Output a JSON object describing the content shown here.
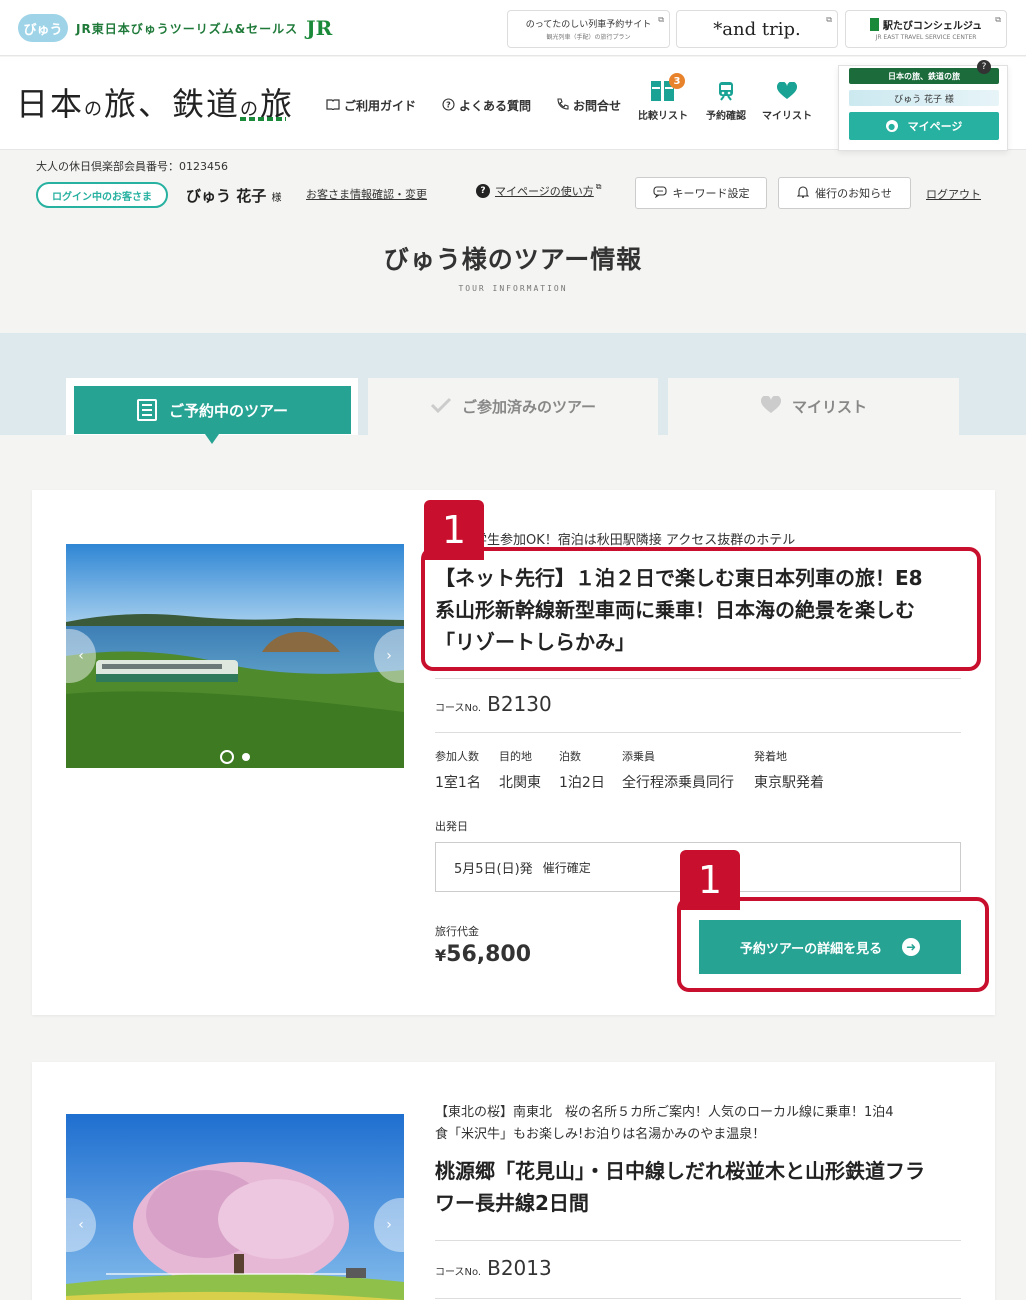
{
  "topbar": {
    "brand_logo": "びゅう",
    "brand_company": "JR東日本びゅうツーリズム&セールス",
    "brand_jr": "JR",
    "ext_sites": [
      {
        "main": "のってたのしい列車予約サイト",
        "sub": "観光列車（手配）の旅行プラン"
      },
      {
        "main": "*and trip.",
        "sub": ""
      },
      {
        "main": "駅たびコンシェルジュ",
        "sub": "JR EAST TRAVEL SERVICE CENTER"
      }
    ],
    "external_icon": "external-link-icon"
  },
  "nav": {
    "logo_part1": "日本",
    "logo_small1": "の",
    "logo_part2": "旅、鉄道",
    "logo_small2": "の",
    "logo_part3": "旅",
    "links": [
      {
        "label": "ご利用ガイド",
        "icon": "book-icon"
      },
      {
        "label": "よくある質問",
        "icon": "question-icon"
      },
      {
        "label": "お問合せ",
        "icon": "phone-icon"
      }
    ],
    "icon_items": [
      {
        "label": "比較リスト",
        "icon": "compare-icon",
        "badge": "3"
      },
      {
        "label": "予約確認",
        "icon": "train-icon"
      },
      {
        "label": "マイリスト",
        "icon": "heart-icon"
      }
    ],
    "mypage": {
      "top": "日本の旅、鉄道の旅",
      "help": "?",
      "user": "びゅう 花子 様",
      "button": "マイページ"
    }
  },
  "member": {
    "number_text": "大人の休日倶楽部会員番号：0123456",
    "login_status": "ログイン中のお客さま",
    "user_name": "びゅう 花子",
    "honorific": "様",
    "info_link": "お客さま情報確認・変更",
    "howto_link": "マイページの使い方",
    "keyword_button": "キーワード設定",
    "notice_button": "催行のお知らせ",
    "logout": "ログアウト"
  },
  "page": {
    "title": "びゅう様のツアー情報",
    "subtitle": "TOUR INFORMATION"
  },
  "tabs": [
    {
      "label": "ご予約中のツアー",
      "active": true
    },
    {
      "label": "ご参加済みのツアー",
      "active": false
    },
    {
      "label": "マイリスト",
      "active": false
    }
  ],
  "tours": [
    {
      "catch": "発！小学生参加OK！宿泊は秋田駅隣接 アクセス抜群のホテル",
      "title_lines": [
        "【ネット先行】１泊２日で楽しむ東日本列車の旅！E8",
        "系山形新幹線新型車両に乗車！日本海の絶景を楽しむ",
        "「リゾートしらかみ」"
      ],
      "course_label": "コースNo.",
      "course_no": "B2130",
      "attrs": [
        {
          "label": "参加人数",
          "value": "1室1名"
        },
        {
          "label": "目的地",
          "value": "北関東"
        },
        {
          "label": "泊数",
          "value": "1泊2日"
        },
        {
          "label": "添乗員",
          "value": "全行程添乗員同行"
        },
        {
          "label": "発着地",
          "value": "東京駅発着"
        }
      ],
      "dep_label": "出発日",
      "dep_date": "5月5日(日)発",
      "dep_status": "催行確定",
      "price_label": "旅行代金",
      "price_yen": "¥",
      "price": "56,800",
      "detail_button": "予約ツアーの詳細を見る"
    },
    {
      "catch_lines": [
        "【東北の桜】南東北　桜の名所５カ所ご案内！人気のローカル線に乗車！1泊4",
        "食「米沢牛」もお楽しみ!お泊りは名湯かみのやま温泉！"
      ],
      "title_lines": [
        "桃源郷「花見山」・日中線しだれ桜並木と山形鉄道フラ",
        "ワー長井線2日間"
      ],
      "course_label": "コースNo.",
      "course_no": "B2013"
    }
  ],
  "annotations": [
    "1",
    "1"
  ],
  "colors": {
    "accent": "#27a394",
    "highlight": "#c8102e",
    "jr_green": "#1a8a3a",
    "badge": "#e8832c"
  }
}
